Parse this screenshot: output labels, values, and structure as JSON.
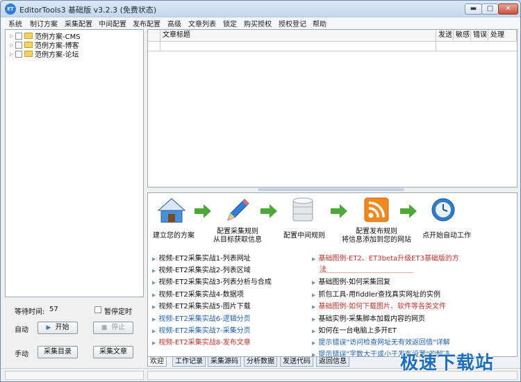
{
  "titlebar": {
    "title": "EditorTools3 基础版 v3.2.3 (免费状态)",
    "icon_text": "ET",
    "min_glyph": "▬",
    "max_glyph": "□",
    "close_glyph": "✕"
  },
  "menu": [
    "系统",
    "制订方案",
    "采集配置",
    "中间配置",
    "发布配置",
    "高级",
    "文章列表",
    "锁定",
    "购买授权",
    "授权登记",
    "帮助"
  ],
  "tree": [
    {
      "label": "范例方案-CMS"
    },
    {
      "label": "范例方案-博客"
    },
    {
      "label": "范例方案-论坛"
    }
  ],
  "controls": {
    "wait_label": "等待时间:",
    "wait_value": "57",
    "pause_timer_label": "暂停定时",
    "auto_label": "自动",
    "start_label": "开始",
    "stop_label": "停止",
    "manual_label": "手动",
    "collect_dir_label": "采集目录",
    "collect_article_label": "采集文章"
  },
  "table": {
    "columns": [
      "文章标题",
      "发送",
      "敏感",
      "错误",
      "处理"
    ]
  },
  "workflow": [
    {
      "label": "建立您的方案",
      "icon": "home-icon"
    },
    {
      "label": "配置采集规则",
      "label2": "从目标获取信息",
      "icon": "pencil-icon"
    },
    {
      "label": "配置中间规则",
      "icon": "database-icon"
    },
    {
      "label": "配置发布规则",
      "label2": "将信息添加到您的网站",
      "icon": "rss-icon"
    },
    {
      "label": "点开始自动工作",
      "icon": "clock-icon"
    }
  ],
  "links_left": [
    {
      "text": "视频-ET2采集实战1-列表网址",
      "color": "black"
    },
    {
      "text": "视频-ET2采集实战2-列表区域",
      "color": "black"
    },
    {
      "text": "视频-ET2采集实战3-列表分析与合成",
      "color": "black"
    },
    {
      "text": "视频-ET2采集实战4-数据项",
      "color": "black"
    },
    {
      "text": "视频-ET2采集实战5-图片下载",
      "color": "black"
    },
    {
      "text": "视频-ET2采集实战6-逻辑分页",
      "color": "blue"
    },
    {
      "text": "视频-ET2采集实战7-采集分页",
      "color": "blue"
    },
    {
      "text": "视频-ET2采集实战8-发布文章",
      "color": "red"
    }
  ],
  "links_right": [
    {
      "text": "基础图例-ET2、ET3beta升级ET3基础版的方",
      "color": "red"
    },
    {
      "text": "法",
      "color": "red",
      "continuation": true
    },
    {
      "text": "基础图例-如何采集回复",
      "color": "black"
    },
    {
      "text": "抓包工具-用fiddler查找真实网址的实例",
      "color": "black"
    },
    {
      "text": "基础图例-如何下载图片、软件等各类文件",
      "color": "red"
    },
    {
      "text": "基础实例-采集脚本加载内容的网页",
      "color": "black"
    },
    {
      "text": "如何在一台电脑上多开ET",
      "color": "black"
    },
    {
      "text": "提示错误\"访问检查网址无有效返回值\"详解",
      "color": "blue"
    },
    {
      "text": "提示错误\"字数大于或小于发布设置\"的解决",
      "color": "blue"
    }
  ],
  "tabs": [
    "欢迎",
    "工作记录",
    "采集源码",
    "分析数据",
    "发送代码",
    "返回信息"
  ],
  "watermark": "极速下载站",
  "colors": {
    "accent": "#2e7bd1",
    "link_red": "#c6312a",
    "link_blue": "#1e5fb4"
  }
}
